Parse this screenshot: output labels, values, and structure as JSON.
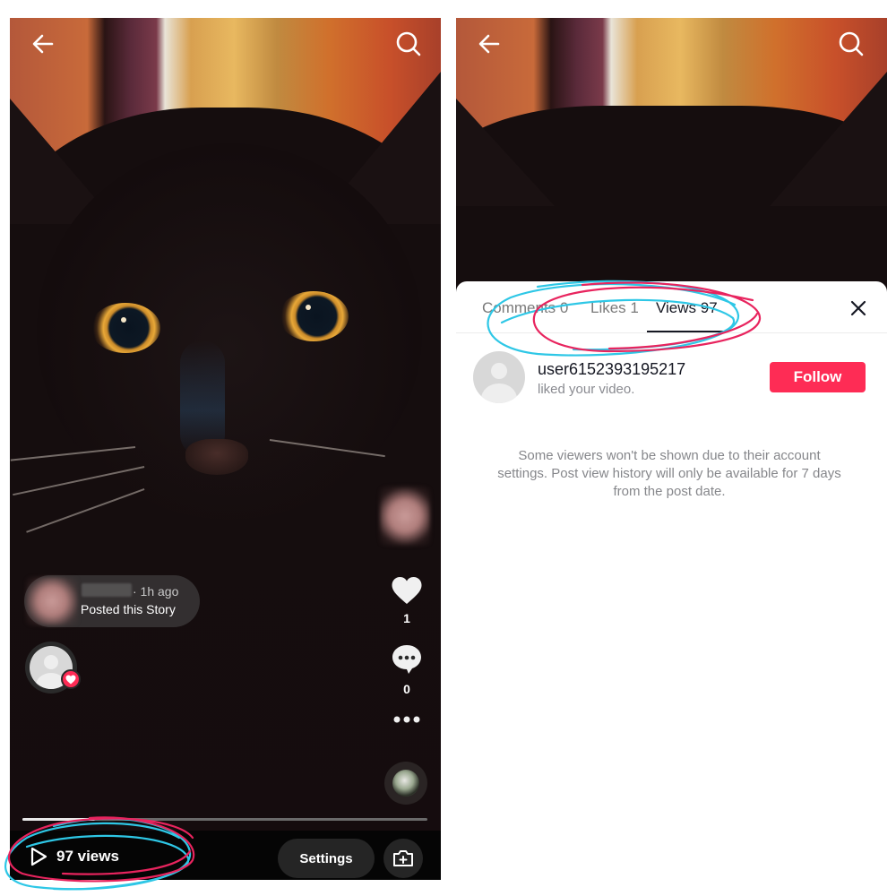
{
  "left_screen": {
    "top_bar": {
      "back_icon": "arrow-left-icon",
      "search_icon": "search-icon"
    },
    "story_notice": {
      "time": "· 1h ago",
      "text": "Posted this Story"
    },
    "right_rail": {
      "like_count": "1",
      "comment_count": "0",
      "more_icon": "ellipsis-icon"
    },
    "playback_progress_fraction": 0.18,
    "bottom_bar": {
      "views_label": "97 views",
      "settings_label": "Settings",
      "camera_icon": "camera-plus-icon"
    }
  },
  "right_screen": {
    "top_bar": {
      "back_icon": "arrow-left-icon",
      "search_icon": "search-icon"
    },
    "sheet": {
      "tabs": [
        {
          "label": "Comments 0",
          "active": false
        },
        {
          "label": "Likes 1",
          "active": false
        },
        {
          "label": "Views 97",
          "active": true
        }
      ],
      "close_icon": "close-icon",
      "activity": [
        {
          "username": "user6152393195217",
          "action": "liked your video.",
          "button_label": "Follow"
        }
      ],
      "notice": "Some viewers won't be shown due to their account settings. Post view history will only be available for 7 days from the post date."
    }
  },
  "colors": {
    "accent_red": "#fe2c55",
    "annotation_pink": "#e8245e",
    "annotation_cyan": "#2ec7e6"
  }
}
